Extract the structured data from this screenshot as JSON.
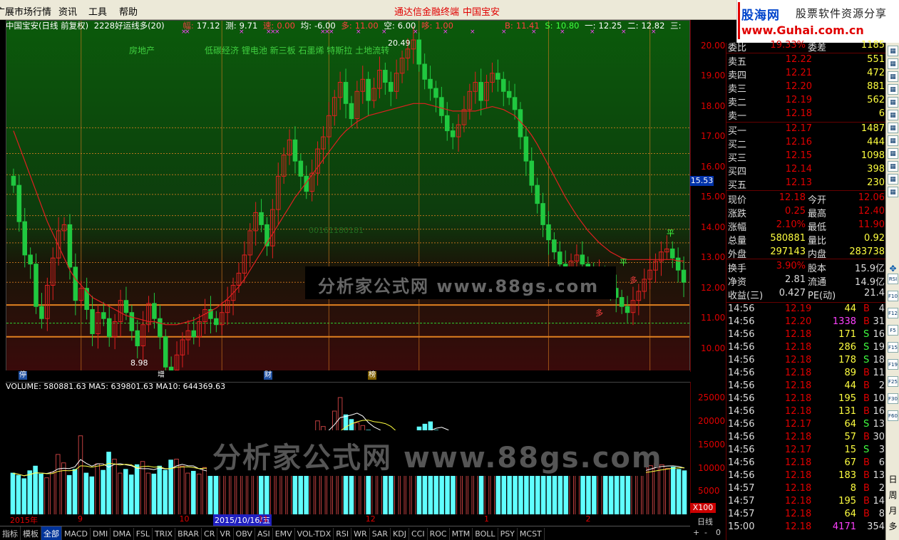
{
  "menubar": {
    "items": [
      "广展市场行情",
      "资讯",
      "工具",
      "帮助"
    ],
    "center_title": "通达信金融终端",
    "stock_title": "中国宝安"
  },
  "logo": {
    "name": "股海网",
    "slogan": "股票软件资源分享",
    "url": "www.Guhai.com.cn"
  },
  "chart_info": {
    "name": "中国宝安(日线 前复权)",
    "indicator": "2228好运线多(20)",
    "fields": [
      {
        "k": "幅:",
        "v": "17.12"
      },
      {
        "k": "测:",
        "v": "9.71"
      },
      {
        "k": "速:",
        "v": "0.00"
      },
      {
        "k": "均:",
        "v": "-6.00"
      },
      {
        "k": "多:",
        "v": "11.00"
      },
      {
        "k": "空:",
        "v": "6.00"
      },
      {
        "k": "哆:",
        "v": "1.00"
      }
    ],
    "right_fields": [
      {
        "k": "B:",
        "v": "11.41"
      },
      {
        "k": "S:",
        "v": "10.80"
      },
      {
        "k": "一:",
        "v": "12.25"
      },
      {
        "k": "二:",
        "v": "12.82"
      },
      {
        "k": "三:",
        "v": ""
      }
    ],
    "concepts": "低碳经济 锂电池 新三板 石墨烯 特斯拉 土地流转",
    "sector": "房地产",
    "high_label": "20.49",
    "low_label": "8.98",
    "mid_label": "00161180181",
    "ping_label": "平",
    "duo_label": "多"
  },
  "chart_data": {
    "type": "candlestick",
    "ylim": [
      9.5,
      20.6
    ],
    "yticks": [
      "20.00",
      "19.00",
      "18.00",
      "17.00",
      "16.00",
      "15.00",
      "14.00",
      "13.00",
      "12.00",
      "11.00",
      "10.00"
    ],
    "ytick_values": [
      20,
      19,
      18,
      17,
      16,
      15,
      14,
      13,
      12,
      11,
      10
    ],
    "current_price_label": "15.53",
    "current_price": 15.53,
    "hlines": [
      17.3,
      16.45,
      15.75,
      15.1,
      14.4,
      13.95,
      13.5,
      12.85,
      12.2
    ],
    "support_lines": [
      11.45,
      10.4
    ],
    "green_line": 10.85,
    "vlines_x_index": [
      12,
      37,
      56,
      72,
      95,
      113
    ],
    "candles_close": [
      15.4,
      14.2,
      13.1,
      12.8,
      11.4,
      11.0,
      12.1,
      13.0,
      13.9,
      14.1,
      12.7,
      11.6,
      12.0,
      11.3,
      10.5,
      11.2,
      11.0,
      10.4,
      10.9,
      11.6,
      11.2,
      10.6,
      10.1,
      10.8,
      11.5,
      11.0,
      10.4,
      9.4,
      9.3,
      9.8,
      10.3,
      10.6,
      10.4,
      10.9,
      11.3,
      11.0,
      10.8,
      11.2,
      11.6,
      12.1,
      12.5,
      13.1,
      13.9,
      14.5,
      14.1,
      13.4,
      14.6,
      15.7,
      16.4,
      16.9,
      16.2,
      15.7,
      15.2,
      15.8,
      16.6,
      17.0,
      17.7,
      18.3,
      18.8,
      18.1,
      17.6,
      18.5,
      18.9,
      18.2,
      18.6,
      19.2,
      18.8,
      18.5,
      19.1,
      19.6,
      19.9,
      20.2,
      19.4,
      18.9,
      18.6,
      18.3,
      17.7,
      17.2,
      17.0,
      17.4,
      17.9,
      18.5,
      18.8,
      18.2,
      18.8,
      19.1,
      18.9,
      18.5,
      18.3,
      17.9,
      17.0,
      16.2,
      15.4,
      14.8,
      14.1,
      13.6,
      13.2,
      12.8,
      12.6,
      12.9,
      13.1,
      12.8,
      12.5,
      12.3,
      12.5,
      12.2,
      12.0,
      11.7,
      11.4,
      11.2,
      11.6,
      11.9,
      12.3,
      12.6,
      12.9,
      13.2,
      13.3,
      13.0,
      12.6,
      12.2
    ],
    "ma_values": [
      17.2,
      16.7,
      16.2,
      15.7,
      15.2,
      14.7,
      14.2,
      13.8,
      13.4,
      13.0,
      12.6,
      12.3,
      12.1,
      11.9,
      11.7,
      11.6,
      11.5,
      11.4,
      11.3,
      11.2,
      11.1,
      11.05,
      11.0,
      10.95,
      10.9,
      10.9,
      10.85,
      10.8,
      10.8,
      10.8,
      10.85,
      10.9,
      10.95,
      11.05,
      11.15,
      11.25,
      11.35,
      11.5,
      11.65,
      11.85,
      12.05,
      12.3,
      12.6,
      12.9,
      13.2,
      13.5,
      13.8,
      14.1,
      14.4,
      14.7,
      15.0,
      15.25,
      15.5,
      15.75,
      16.0,
      16.25,
      16.5,
      16.75,
      17.0,
      17.2,
      17.35,
      17.5,
      17.6,
      17.7,
      17.75,
      17.8,
      17.85,
      17.9,
      17.95,
      18.0,
      18.05,
      18.1,
      18.1,
      18.1,
      18.05,
      18.0,
      17.95,
      17.9,
      17.85,
      17.85,
      17.85,
      17.85,
      17.85,
      17.9,
      17.95,
      18.0,
      17.95,
      17.9,
      17.8,
      17.7,
      17.5,
      17.3,
      17.05,
      16.75,
      16.4,
      16.05,
      15.7,
      15.35,
      15.0,
      14.7,
      14.4,
      14.15,
      13.9,
      13.7,
      13.5,
      13.35,
      13.2,
      13.1,
      13.0,
      12.95,
      12.95,
      12.95,
      12.95,
      12.95,
      12.95,
      12.95,
      12.95,
      12.95,
      12.9,
      12.9
    ]
  },
  "marks": [
    {
      "label": "停",
      "bg": "#2050a0"
    },
    {
      "label": "增",
      "bg": "#000000"
    },
    {
      "label": "财",
      "bg": "#2050a0"
    },
    {
      "label": "榜",
      "bg": "#806000"
    }
  ],
  "volume_info": {
    "volume": "VOLUME: 580881.63",
    "ma5": "MA5: 639801.63",
    "ma10": "MA10: 644369.63"
  },
  "volume_axis": [
    "25000",
    "20000",
    "15000",
    "10000",
    "5000"
  ],
  "volume_axis_values": [
    25000,
    20000,
    15000,
    10000,
    5000
  ],
  "volume_unit": "X100",
  "volume_values": [
    9000,
    8500,
    7800,
    9500,
    10500,
    8800,
    8000,
    9200,
    13000,
    11200,
    8500,
    9800,
    17000,
    9000,
    8200,
    11000,
    9600,
    13500,
    12000,
    9000,
    9800,
    8600,
    10800,
    11500,
    9000,
    8800,
    10500,
    9600,
    11800,
    12000,
    10500,
    9000,
    9400,
    8800,
    10200,
    8900,
    10100,
    9600,
    9900,
    10300,
    11200,
    12300,
    12600,
    10600,
    11000,
    9500,
    10800,
    12100,
    13200,
    12800,
    13700,
    15200,
    16200,
    17600,
    20200,
    19000,
    17800,
    22300,
    25200,
    21500,
    20500,
    19800,
    19200,
    18200,
    16800,
    17500,
    15200,
    16200,
    14500,
    16100,
    15800,
    16500,
    18900,
    19500,
    20000,
    18200,
    17500,
    16500,
    15500,
    14800,
    15500,
    16100,
    16800,
    15000,
    15400,
    16500,
    15800,
    14200,
    13200,
    12200,
    11500,
    11000,
    10300,
    9800,
    10500,
    10800,
    10000,
    9500,
    9000,
    9600,
    10200,
    9700,
    9300,
    8800,
    9100,
    8600,
    8300,
    8600,
    8900,
    9300,
    9700,
    9600,
    10100,
    10600,
    11100,
    10800,
    10000,
    10300,
    9800,
    9500
  ],
  "date_labels": [
    {
      "label": "2015年",
      "idx": 0
    },
    {
      "label": "9",
      "idx": 12
    },
    {
      "label": "10",
      "idx": 30
    },
    {
      "label": "2015/10/16/五",
      "idx": 36,
      "current": true
    },
    {
      "label": "11",
      "idx": 44
    },
    {
      "label": "12",
      "idx": 63
    },
    {
      "label": "1",
      "idx": 84
    },
    {
      "label": "2",
      "idx": 102
    }
  ],
  "tabs": [
    "指标",
    "模板",
    "全部",
    "MACD",
    "DMI",
    "DMA",
    "FSL",
    "TRIX",
    "BRAR",
    "CR",
    "VR",
    "OBV",
    "ASI",
    "EMV",
    "VOL-TDX",
    "RSI",
    "WR",
    "SAR",
    "KDJ",
    "CCI",
    "ROC",
    "MTM",
    "BOLL",
    "PSY",
    "MCST"
  ],
  "right_controls": {
    "period": "日线",
    "btn1": "+",
    "btn2": "-",
    "btn3": "0"
  },
  "quote": {
    "weibi": {
      "k": "委比",
      "p": "19.33%",
      "k2": "委差",
      "v": "1185"
    },
    "asks": [
      {
        "k": "卖五",
        "p": "12.22",
        "v": "551"
      },
      {
        "k": "卖四",
        "p": "12.21",
        "v": "472"
      },
      {
        "k": "卖三",
        "p": "12.20",
        "v": "881"
      },
      {
        "k": "卖二",
        "p": "12.19",
        "v": "562"
      },
      {
        "k": "卖一",
        "p": "12.18",
        "v": "6"
      }
    ],
    "bids": [
      {
        "k": "买一",
        "p": "12.17",
        "v": "1487"
      },
      {
        "k": "买二",
        "p": "12.16",
        "v": "444"
      },
      {
        "k": "买三",
        "p": "12.15",
        "v": "1098"
      },
      {
        "k": "买四",
        "p": "12.14",
        "v": "398"
      },
      {
        "k": "买五",
        "p": "12.13",
        "v": "230"
      }
    ],
    "stats1": [
      {
        "k1": "现价",
        "v1": "12.18",
        "k2": "今开",
        "v2": "12.06"
      },
      {
        "k1": "涨跌",
        "v1": "0.25",
        "k2": "最高",
        "v2": "12.40"
      },
      {
        "k1": "涨幅",
        "v1": "2.10%",
        "k2": "最低",
        "v2": "11.90"
      },
      {
        "k1": "总量",
        "v1": "580881",
        "k2": "量比",
        "v2": "0.92"
      },
      {
        "k1": "外盘",
        "v1": "297143",
        "k2": "内盘",
        "v2": "283738"
      }
    ],
    "stats2": [
      {
        "k1": "换手",
        "v1": "3.90%",
        "k2": "股本",
        "v2": "15.9亿"
      },
      {
        "k1": "净资",
        "v1": "2.81",
        "k2": "流通",
        "v2": "14.9亿"
      },
      {
        "k1": "收益(三)",
        "v1": "0.427",
        "k2": "PE(动)",
        "v2": "21.4"
      }
    ],
    "ticks": [
      {
        "t": "14:56",
        "p": "12.19",
        "v": "44",
        "d": "B",
        "n": "4"
      },
      {
        "t": "14:56",
        "p": "12.20",
        "v": "1338",
        "d": "B",
        "n": "31",
        "m": true
      },
      {
        "t": "14:56",
        "p": "12.18",
        "v": "171",
        "d": "S",
        "n": "16"
      },
      {
        "t": "14:56",
        "p": "12.18",
        "v": "286",
        "d": "S",
        "n": "19"
      },
      {
        "t": "14:56",
        "p": "12.18",
        "v": "178",
        "d": "S",
        "n": "18"
      },
      {
        "t": "14:56",
        "p": "12.18",
        "v": "89",
        "d": "B",
        "n": "11"
      },
      {
        "t": "14:56",
        "p": "12.18",
        "v": "44",
        "d": "B",
        "n": "2"
      },
      {
        "t": "14:56",
        "p": "12.18",
        "v": "195",
        "d": "B",
        "n": "10"
      },
      {
        "t": "14:56",
        "p": "12.18",
        "v": "131",
        "d": "B",
        "n": "16"
      },
      {
        "t": "14:56",
        "p": "12.17",
        "v": "64",
        "d": "S",
        "n": "13"
      },
      {
        "t": "14:56",
        "p": "12.18",
        "v": "57",
        "d": "B",
        "n": "30"
      },
      {
        "t": "14:56",
        "p": "12.17",
        "v": "15",
        "d": "S",
        "n": "3"
      },
      {
        "t": "14:56",
        "p": "12.18",
        "v": "67",
        "d": "B",
        "n": "6"
      },
      {
        "t": "14:56",
        "p": "12.18",
        "v": "183",
        "d": "B",
        "n": "13"
      },
      {
        "t": "14:57",
        "p": "12.18",
        "v": "8",
        "d": "B",
        "n": "2"
      },
      {
        "t": "14:57",
        "p": "12.18",
        "v": "195",
        "d": "B",
        "n": "14"
      },
      {
        "t": "14:57",
        "p": "12.18",
        "v": "64",
        "d": "B",
        "n": "8"
      },
      {
        "t": "15:00",
        "p": "12.18",
        "v": "4171",
        "d": "",
        "n": "354",
        "m": true
      }
    ]
  },
  "right_toolbar": {
    "icons": [
      "RSI",
      "F10",
      "F12",
      "F5",
      "F15",
      "F19",
      "F25",
      "F30",
      "F60"
    ],
    "chars": [
      "日",
      "周",
      "月",
      "多"
    ]
  },
  "watermarks": {
    "top": "分析家公式网 www.88gs.com",
    "bottom": "分析家公式网 www.88gs.com"
  },
  "colors": {
    "up": "#e02020",
    "down": "#20c840",
    "ma": "#e02020",
    "vol_up": "#c04040",
    "vol_down": "#60ffff",
    "grid_orange": "#e08020"
  }
}
